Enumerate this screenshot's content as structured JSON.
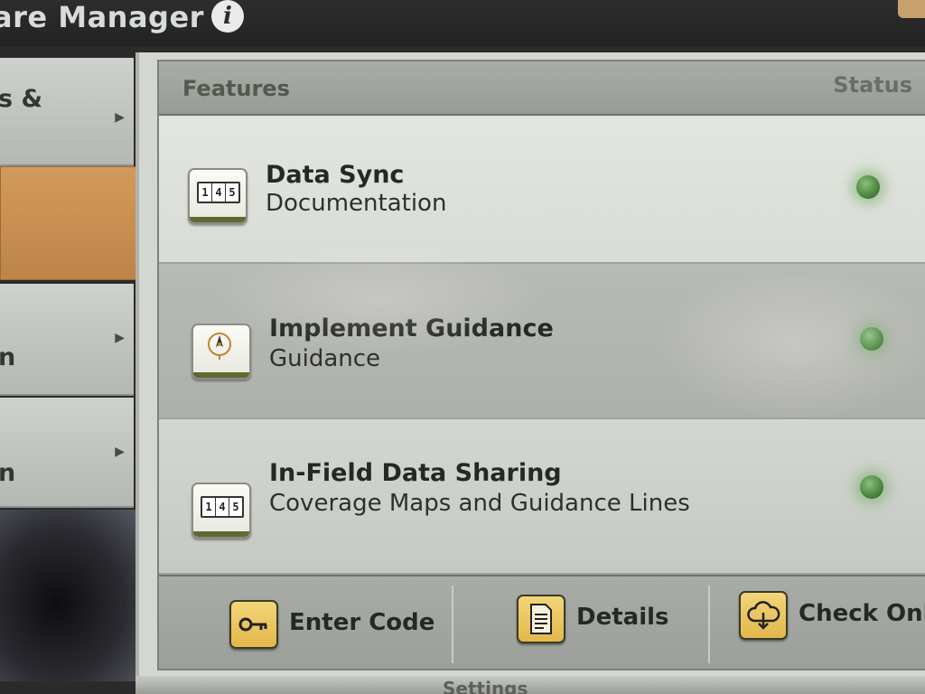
{
  "app": {
    "title": "are Manager",
    "info_icon": "info-icon"
  },
  "nav": {
    "items": [
      {
        "label": "s &",
        "icon": "chevron-right-icon"
      },
      {
        "label": "",
        "active": true
      },
      {
        "label": "n",
        "icon": "chevron-right-icon"
      },
      {
        "label": "n",
        "icon": "chevron-right-icon"
      }
    ]
  },
  "table": {
    "columns": {
      "features": "Features",
      "status": "Status"
    },
    "rows": [
      {
        "title": "Data Sync",
        "subtitle": "Documentation",
        "icon": "counter-icon",
        "glyph": [
          "1",
          "4",
          "5"
        ],
        "status_color": "#4f8a44"
      },
      {
        "title": "Implement Guidance",
        "subtitle": "Guidance",
        "icon": "compass-icon",
        "status_color": "#4f8a44"
      },
      {
        "title": "In-Field Data Sharing",
        "subtitle": "Coverage Maps and Guidance Lines",
        "icon": "counter-icon",
        "glyph": [
          "1",
          "4",
          "5"
        ],
        "status_color": "#4f8a44"
      }
    ]
  },
  "buttons": {
    "enter_code": {
      "label": "Enter Code",
      "icon": "key-icon"
    },
    "details": {
      "label": "Details",
      "icon": "document-icon"
    },
    "check_online": {
      "label": "Check Onli",
      "icon": "cloud-download-icon"
    }
  },
  "bottom": {
    "partial_label": "Settings"
  },
  "colors": {
    "accent_orange": "#c98f4f",
    "button_yellow": "#e2b84a",
    "status_green": "#4f8a44"
  }
}
